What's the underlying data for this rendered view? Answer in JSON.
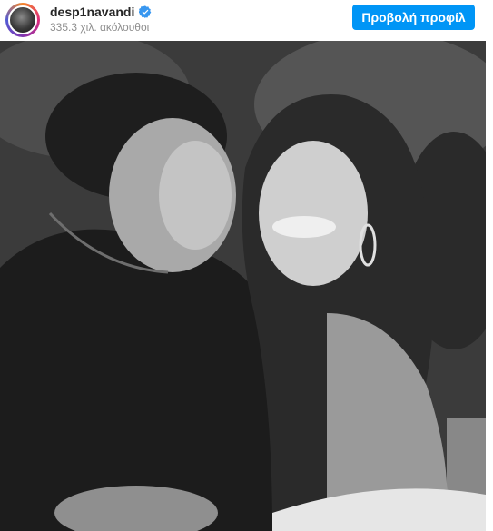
{
  "post": {
    "username": "desp1navandi",
    "followers_text": "335.3 χιλ. ακόλουθοι",
    "view_profile_label": "Προβολή προφίλ",
    "verified_icon": "verified-badge-icon",
    "accent_color": "#0095f6"
  }
}
